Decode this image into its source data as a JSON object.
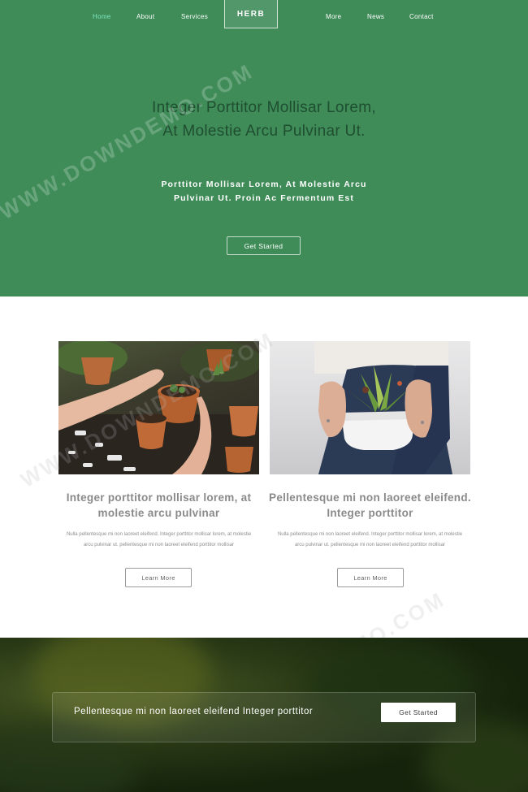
{
  "nav": {
    "items_left": [
      "Home",
      "About",
      "Services"
    ],
    "brand": "HERB",
    "items_right": [
      "More",
      "News",
      "Contact"
    ],
    "active": "Home"
  },
  "hero": {
    "title": "Integer Porttitor Mollisar Lorem, At Molestie Arcu Pulvinar Ut.",
    "subtitle": "Porttitor Mollisar Lorem, At Molestie Arcu Pulvinar Ut. Proin Ac Fermentum Est",
    "button": "Get Started"
  },
  "cards": [
    {
      "image_alt": "hands-planting-succulent-in-terracotta-pot",
      "title": "Integer porttitor mollisar lorem, at molestie arcu pulvinar",
      "text": "Nulla pellentesque mi non laoreet eleifend. Integer porttitor mollisar lorem, at molestie arcu pulvinar ut. pellentesque mi non laoreet eleifend porttitor mollisar",
      "button": "Learn More"
    },
    {
      "image_alt": "hands-holding-white-pot-with-succulent",
      "title": "Pellentesque mi non laoreet eleifend. Integer porttitor",
      "text": "Nulla pellentesque mi non laoreet eleifend. Integer porttitor mollisar lorem, at molestie arcu pulvinar ut. pellentesque mi non laoreet eleifend porttitor mollisar",
      "button": "Learn More"
    }
  ],
  "cta": {
    "text": "Pellentesque mi non laoreet eleifend Integer porttitor",
    "button": "Get Started"
  },
  "watermark": "WWW.DOWNDEMO.COM",
  "colors": {
    "hero_bg": "#3f8c58",
    "nav_active": "#7ee6c1",
    "hero_title": "#1f4e30",
    "cta_bg": "#1d2b10"
  }
}
